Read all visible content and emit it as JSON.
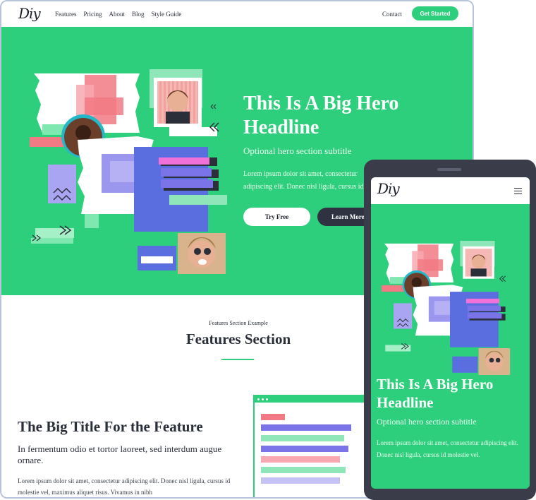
{
  "nav": {
    "logo": "Diy",
    "links": [
      "Features",
      "Pricing",
      "About",
      "Blog",
      "Style Guide"
    ],
    "contact": "Contact",
    "cta": "Get Started"
  },
  "hero": {
    "title": "This Is A Big Hero Headline",
    "subtitle": "Optional hero section subtitle",
    "body": "Lorem ipsum dolor sit amet, consectetur adipiscing elit. Donec nisl ligula, cursus id molestie vel.",
    "primary_button": "Try Free",
    "secondary_button": "Learn More"
  },
  "features": {
    "kicker": "Features Section Example",
    "title": "Features Section"
  },
  "feature_item": {
    "title": "The Big Title For the Feature",
    "subtitle": "In fermentum odio et tortor laoreet, sed interdum augue ornare.",
    "body": "Lorem ipsum dolor sit amet, consectetur adipiscing elit. Donec nisl ligula, cursus id molestie vel, maximus aliquet risus. Vivamus in nibh"
  },
  "mobile": {
    "logo": "Diy",
    "menu_icon": "hamburger-menu-icon",
    "title": "This Is A Big Hero Headline",
    "subtitle": "Optional hero section subtitle",
    "body": "Lorem ipsum dolor sit amet, consectetur adipiscing elit. Donec nisl ligula, cursus id molestie vel."
  },
  "colors": {
    "brand_green": "#2ecf7c",
    "dark": "#2f3341",
    "phone_frame": "#3a3d49"
  }
}
